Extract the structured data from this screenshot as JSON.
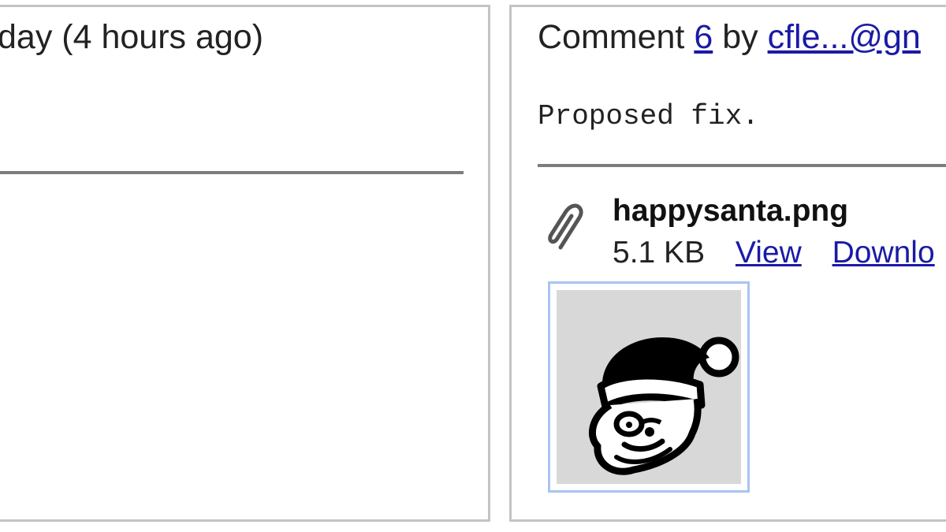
{
  "left_panel": {
    "meta_text": "day (4 hours ago)"
  },
  "right_panel": {
    "comment_prefix": "Comment",
    "comment_number": "6",
    "by_text": "by",
    "author": "cfle...@gn",
    "comment_text": "Proposed fix.",
    "attachment": {
      "icon": "paperclip-icon",
      "filename": "happysanta.png",
      "size": "5.1 KB",
      "view_label": "View",
      "download_label": "Downlo",
      "thumbnail_icon": "santa-face-icon"
    }
  },
  "colors": {
    "link": "#1a1aa6",
    "panel_border": "#c4c4c4",
    "divider": "#7d7d7d",
    "thumb_border": "#a9c4f2",
    "thumb_bg": "#d8d8d8"
  }
}
